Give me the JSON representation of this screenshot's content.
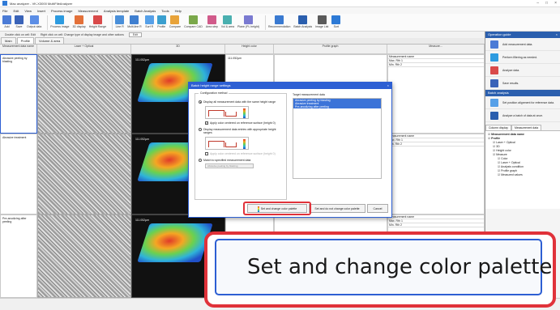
{
  "window": {
    "title": "Mao analyzer - VK-X3000 MultiFileAnalyzer"
  },
  "menu": [
    "File",
    "Edit",
    "View",
    "Insert",
    "Process image",
    "Measurement",
    "Analysis template",
    "Batch Analysis",
    "Tools",
    "Help"
  ],
  "ribbon": [
    {
      "label": "Add",
      "color": "#4b7bd6"
    },
    {
      "label": "Save",
      "color": "#3a63b8"
    },
    {
      "label": "Output data",
      "color": "#5c8ee6"
    },
    {
      "label": "Process image",
      "color": "#2d9be0"
    },
    {
      "label": "3D display",
      "color": "#e3713a"
    },
    {
      "label": "Height Range",
      "color": "#d94a4a"
    },
    {
      "label": "Line R",
      "color": "#4a8fd9"
    },
    {
      "label": "Multi-line R",
      "color": "#3f7fd0"
    },
    {
      "label": "Surf R",
      "color": "#56a0e8"
    },
    {
      "label": "Profile",
      "color": "#3a9fcf"
    },
    {
      "label": "Compare",
      "color": "#e8a33a"
    },
    {
      "label": "Compare CAD",
      "color": "#7aa84a"
    },
    {
      "label": "Area step",
      "color": "#d15a8a"
    },
    {
      "label": "Vol & area",
      "color": "#4ab0b0"
    },
    {
      "label": "Plane (PL height)",
      "color": "#7a7ad1"
    },
    {
      "label": "Recommendation",
      "color": "#3a7ad1"
    },
    {
      "label": "Batch Analysis",
      "color": "#2b5fae"
    },
    {
      "label": "Image List",
      "color": "#5a5a5a"
    },
    {
      "label": "Sort",
      "color": "#2d7ad6"
    }
  ],
  "hints": {
    "double_click": "Double click on cell: Edit",
    "right_click": "Right click on cell: Change type of display image and other actions",
    "edit_button": "Edit"
  },
  "tabs": [
    "Main",
    "Profile",
    "Volume & area"
  ],
  "grid": {
    "headers": [
      "Measurement data name",
      "Laser + Optical",
      "3D",
      "Height color",
      "Profile graph"
    ],
    "measurement_header": "Measure...",
    "rows": [
      {
        "name": "Abrasive peeling by blasting",
        "scale": "111.052μm"
      },
      {
        "name": "Abrasive treatment",
        "scale": "111.052μm"
      },
      {
        "name": "Pre-anodizing after peeling",
        "scale": "111.052μm"
      }
    ],
    "meas_labels": [
      "Measurement name",
      "Max. Rth 1",
      "Min. Rth 2"
    ]
  },
  "sidebar": {
    "guide_title": "Operation guide",
    "guide_items": [
      {
        "label": "Add measurement data.",
        "color": "#4b7bd6"
      },
      {
        "label": "Perform filtering as needed.",
        "color": "#2d9be0"
      },
      {
        "label": "Analyze data.",
        "color": "#d94a4a"
      },
      {
        "label": "Save results.",
        "color": "#3a63b8"
      }
    ],
    "batch_title": "Batch analysis",
    "batch_items": [
      {
        "label": "Set position alignment for reference data.",
        "color": "#56a0e8"
      },
      {
        "label": "Analyze a batch of data at once.",
        "color": "#2b5fae"
      }
    ],
    "subtabs": [
      "Column display",
      "Measurement data"
    ],
    "tree": [
      {
        "text": "Measurement data name",
        "lvl": 0,
        "bold": true
      },
      {
        "text": "Profile",
        "lvl": 0,
        "bold": true
      },
      {
        "text": "Laser + Optical",
        "lvl": 1
      },
      {
        "text": "3D",
        "lvl": 1
      },
      {
        "text": "Height color",
        "lvl": 1
      },
      {
        "text": "Measure",
        "lvl": 1
      },
      {
        "text": "Color",
        "lvl": 2
      },
      {
        "text": "Laser + Optical",
        "lvl": 2
      },
      {
        "text": "Analysis condition",
        "lvl": 2
      },
      {
        "text": "Profile graph",
        "lvl": 2
      },
      {
        "text": "Measured values",
        "lvl": 2
      }
    ]
  },
  "dialog": {
    "title": "Batch height range settings",
    "config_label": "Configuration method",
    "opt1": "Display all measurement data with the same height range",
    "chk1": "Apply color centered on reference surface (height 0)",
    "opt2": "Display measurement data entries with appropriate height ranges",
    "chk2": "Apply color centered on reference surface (height 0)",
    "opt3": "Match to specified measurement data",
    "combo_value": "Abrasive peeling by blasting",
    "target_label": "Target measurement data",
    "targets": [
      "Abrasive peeling by blasting",
      "Abrasive treatment",
      "Pre-anodizing after peeling"
    ],
    "btn_set_palette": "Set and change color palette",
    "btn_set_keep": "Set and do not change color palette",
    "btn_cancel": "Cancel"
  },
  "callout": {
    "text": "Set and change color palette"
  },
  "colors": {
    "accent": "#2d5fd3",
    "highlight": "#e0323a"
  }
}
